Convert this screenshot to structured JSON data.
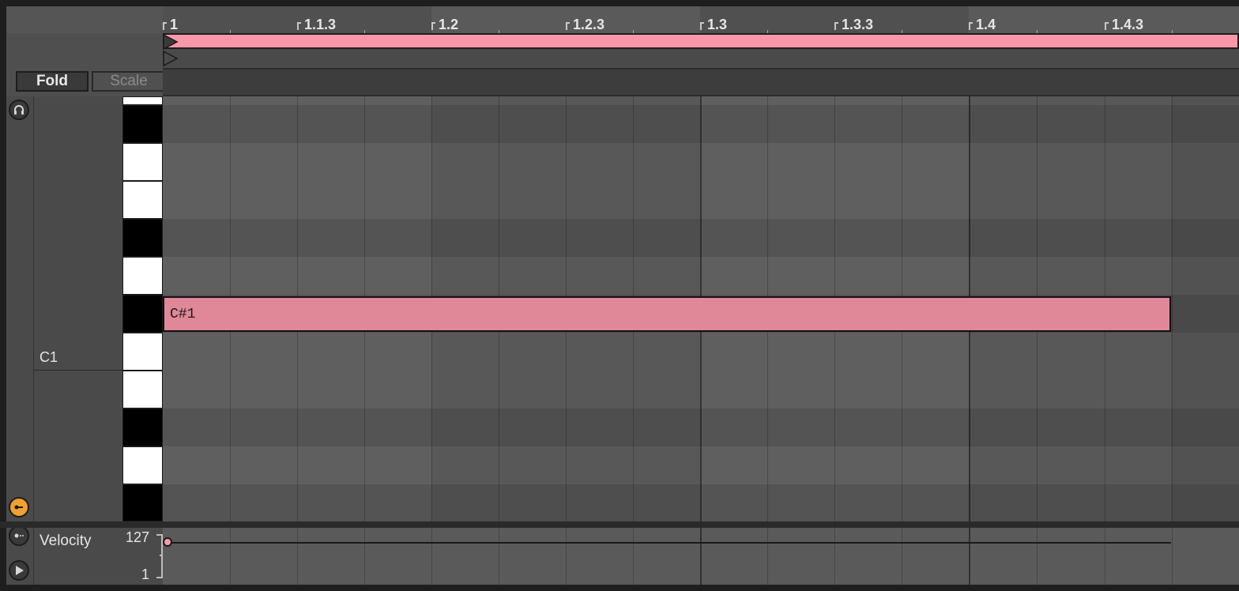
{
  "header": {
    "fold_label": "Fold",
    "scale_label": "Scale"
  },
  "ruler": {
    "labels": [
      "1",
      "1.1.3",
      "1.2",
      "1.2.3",
      "1.3",
      "1.3.3",
      "1.4",
      "1.4.3"
    ]
  },
  "note_names": {
    "c1_label": "C1"
  },
  "note": {
    "label": "C#1"
  },
  "velocity": {
    "title": "Velocity",
    "max": "127",
    "min": "1"
  },
  "icons": {
    "left_strip": [
      "headphones-icon",
      "fold-toggle-icon",
      "envelope-dots-icon",
      "play-icon"
    ]
  },
  "colors": {
    "note": "#e08898",
    "loop_bar": "#f797a8",
    "accent_orange": "#f0a030"
  }
}
